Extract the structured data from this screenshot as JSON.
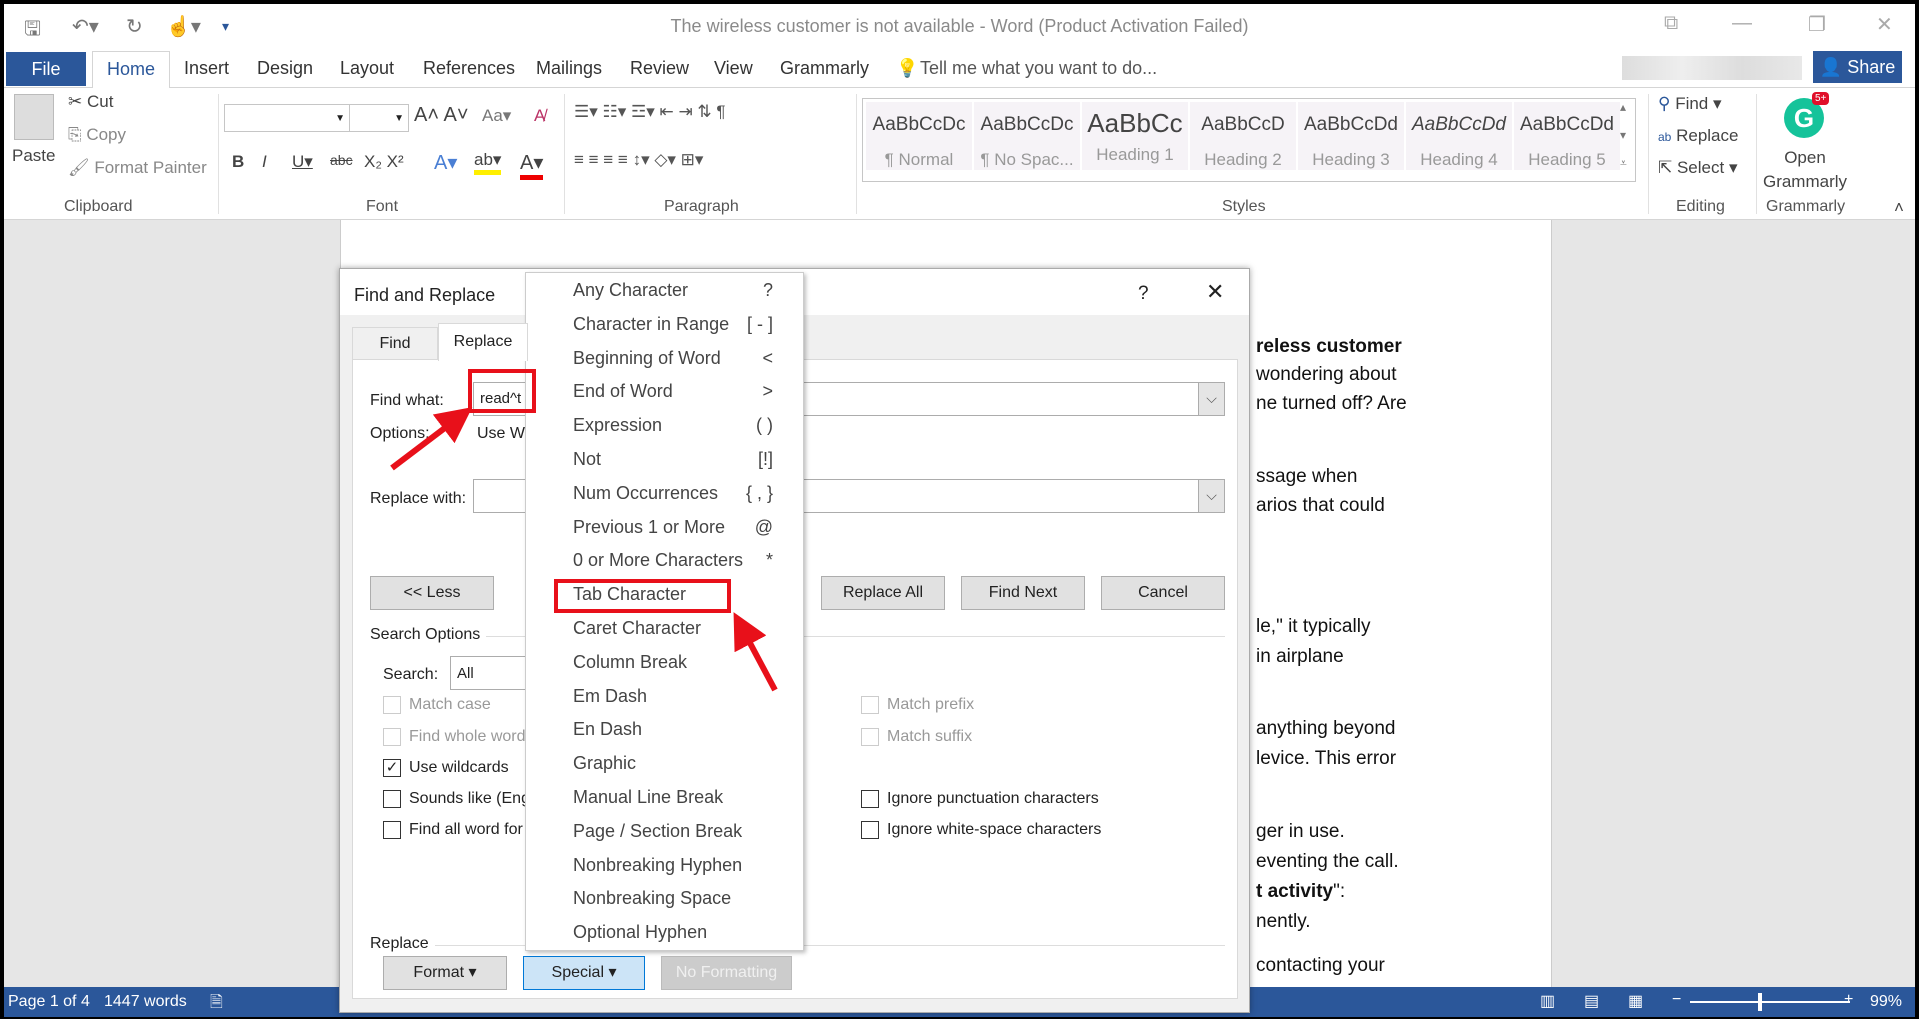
{
  "window": {
    "title": "The wireless customer is not available - Word (Product Activation Failed)"
  },
  "tabs": {
    "file": "File",
    "home": "Home",
    "items": [
      "Insert",
      "Design",
      "Layout",
      "References",
      "Mailings",
      "Review",
      "View",
      "Grammarly"
    ],
    "tell_me": "Tell me what you want to do...",
    "share": "Share"
  },
  "ribbon": {
    "clipboard": {
      "paste": "Paste",
      "cut": "Cut",
      "copy": "Copy",
      "format_painter": "Format Painter",
      "label": "Clipboard"
    },
    "font": {
      "label": "Font",
      "name": "",
      "size": ""
    },
    "paragraph": {
      "label": "Paragraph"
    },
    "styles": {
      "label": "Styles",
      "items": [
        {
          "preview": "AaBbCcDc",
          "name": "¶ Normal"
        },
        {
          "preview": "AaBbCcDc",
          "name": "¶ No Spac..."
        },
        {
          "preview": "AaBbCc",
          "name": "Heading 1"
        },
        {
          "preview": "AaBbCcD",
          "name": "Heading 2"
        },
        {
          "preview": "AaBbCcDd",
          "name": "Heading 3"
        },
        {
          "preview": "AaBbCcDd",
          "name": "Heading 4"
        },
        {
          "preview": "AaBbCcDd",
          "name": "Heading 5"
        }
      ]
    },
    "editing": {
      "label": "Editing",
      "find": "Find",
      "replace": "Replace",
      "select": "Select"
    },
    "grammarly": {
      "label": "Grammarly",
      "open": "Open",
      "name": "Grammarly",
      "badge": "5+",
      "color": "#15c39a"
    }
  },
  "document": {
    "lines": [
      "reless customer",
      "wondering about",
      "ne turned off? Are",
      "ssage when",
      "arios that could",
      "le,\" it typically",
      "in airplane",
      "anything beyond",
      "levice. This error",
      "ger in use.",
      "eventing the call.",
      "t activity",
      "nently.",
      "contacting your"
    ],
    "line12_suffix": "\":"
  },
  "dialog": {
    "title": "Find and Replace",
    "help": "?",
    "tabs": [
      "Find",
      "Replace"
    ],
    "find_what_label": "Find what:",
    "find_what_value": "read^t",
    "options_label": "Options:",
    "options_value": "Use Wi",
    "replace_with_label": "Replace with:",
    "replace_with_value": "",
    "less": "<< Less",
    "replace_all": "Replace All",
    "find_next": "Find Next",
    "cancel": "Cancel",
    "search_options": "Search Options",
    "search_label": "Search:",
    "search_value": "All",
    "left_checks": [
      {
        "label": "Match case",
        "checked": false,
        "disabled": true
      },
      {
        "label": "Find whole word",
        "checked": false,
        "disabled": true
      },
      {
        "label": "Use wildcards",
        "checked": true,
        "disabled": false
      },
      {
        "label": "Sounds like (Eng",
        "checked": false,
        "disabled": false
      },
      {
        "label": "Find all word for",
        "checked": false,
        "disabled": false
      }
    ],
    "right_checks": [
      {
        "label": "Match prefix",
        "checked": false,
        "disabled": true
      },
      {
        "label": "Match suffix",
        "checked": false,
        "disabled": true
      },
      {
        "label": "Ignore punctuation characters",
        "checked": false,
        "disabled": false
      },
      {
        "label": "Ignore white-space characters",
        "checked": false,
        "disabled": false
      }
    ],
    "replace_section": "Replace",
    "format": "Format",
    "special": "Special",
    "no_formatting": "No Formatting"
  },
  "special_menu": [
    {
      "label": "Any Character",
      "key": "?"
    },
    {
      "label": "Character in Range",
      "key": "[ - ]"
    },
    {
      "label": "Beginning of Word",
      "key": "<"
    },
    {
      "label": "End of Word",
      "key": ">"
    },
    {
      "label": "Expression",
      "key": "( )"
    },
    {
      "label": "Not",
      "key": "[!]"
    },
    {
      "label": "Num Occurrences",
      "key": "{ , }"
    },
    {
      "label": "Previous 1 or More",
      "key": "@"
    },
    {
      "label": "0 or More Characters",
      "key": "*"
    },
    {
      "label": "Tab Character",
      "key": "",
      "highlighted": true
    },
    {
      "label": "Caret Character",
      "key": ""
    },
    {
      "label": "Column Break",
      "key": ""
    },
    {
      "label": "Em Dash",
      "key": ""
    },
    {
      "label": "En Dash",
      "key": ""
    },
    {
      "label": "Graphic",
      "key": ""
    },
    {
      "label": "Manual Line Break",
      "key": ""
    },
    {
      "label": "Page / Section Break",
      "key": ""
    },
    {
      "label": "Nonbreaking Hyphen",
      "key": ""
    },
    {
      "label": "Nonbreaking Space",
      "key": ""
    },
    {
      "label": "Optional Hyphen",
      "key": ""
    }
  ],
  "status": {
    "page": "Page 1 of 4",
    "words": "1447 words",
    "zoom": "99%"
  },
  "colors": {
    "accent": "#2b579a",
    "annotation": "#e8101a"
  }
}
